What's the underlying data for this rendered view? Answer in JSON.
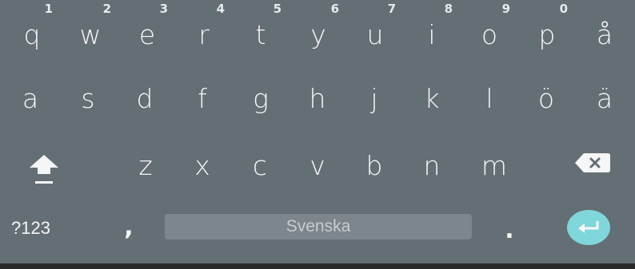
{
  "keyboard": {
    "row1": [
      {
        "label": "q",
        "hint": "1"
      },
      {
        "label": "w",
        "hint": "2"
      },
      {
        "label": "e",
        "hint": "3"
      },
      {
        "label": "r",
        "hint": "4"
      },
      {
        "label": "t",
        "hint": "5"
      },
      {
        "label": "y",
        "hint": "6"
      },
      {
        "label": "u",
        "hint": "7"
      },
      {
        "label": "i",
        "hint": "8"
      },
      {
        "label": "o",
        "hint": "9"
      },
      {
        "label": "p",
        "hint": "0"
      },
      {
        "label": "å",
        "hint": ""
      }
    ],
    "row2": [
      "a",
      "s",
      "d",
      "f",
      "g",
      "h",
      "j",
      "k",
      "l",
      "ö",
      "ä"
    ],
    "row3": [
      "z",
      "x",
      "c",
      "v",
      "b",
      "n",
      "m"
    ],
    "bottom": {
      "symbols_label": "?123",
      "comma_label": ",",
      "space_label": "Svenska",
      "period_label": "."
    },
    "icons": {
      "shift": "shift-icon",
      "backspace": "backspace-icon",
      "enter": "enter-icon"
    },
    "colors": {
      "background": "#646E75",
      "space_bar": "#7D868C",
      "enter_accent": "#7FD6DB",
      "key_text": "#F4F6F7"
    }
  }
}
